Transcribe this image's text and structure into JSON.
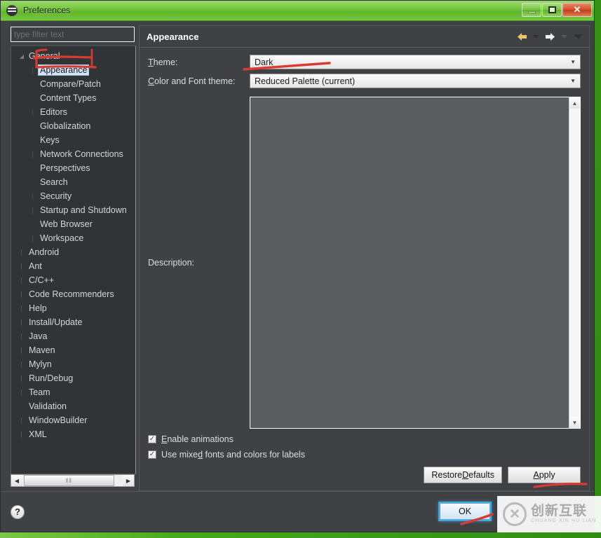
{
  "window": {
    "title": "Preferences",
    "icon": "preferences-icon",
    "buttons": {
      "minimize": "minimize",
      "maximize": "maximize",
      "close": "✕"
    }
  },
  "filter": {
    "placeholder": "type filter text",
    "value": ""
  },
  "tree": {
    "items": [
      {
        "label": "General",
        "level": 1,
        "state": "expanded",
        "selected": false
      },
      {
        "label": "Appearance",
        "level": 2,
        "state": "collapsed",
        "selected": true
      },
      {
        "label": "Compare/Patch",
        "level": 2,
        "state": "none",
        "selected": false
      },
      {
        "label": "Content Types",
        "level": 2,
        "state": "none",
        "selected": false
      },
      {
        "label": "Editors",
        "level": 2,
        "state": "collapsed",
        "selected": false
      },
      {
        "label": "Globalization",
        "level": 2,
        "state": "none",
        "selected": false
      },
      {
        "label": "Keys",
        "level": 2,
        "state": "none",
        "selected": false
      },
      {
        "label": "Network Connections",
        "level": 2,
        "state": "collapsed",
        "selected": false
      },
      {
        "label": "Perspectives",
        "level": 2,
        "state": "none",
        "selected": false
      },
      {
        "label": "Search",
        "level": 2,
        "state": "none",
        "selected": false
      },
      {
        "label": "Security",
        "level": 2,
        "state": "collapsed",
        "selected": false
      },
      {
        "label": "Startup and Shutdown",
        "level": 2,
        "state": "collapsed",
        "selected": false
      },
      {
        "label": "Web Browser",
        "level": 2,
        "state": "none",
        "selected": false
      },
      {
        "label": "Workspace",
        "level": 2,
        "state": "collapsed",
        "selected": false
      },
      {
        "label": "Android",
        "level": 1,
        "state": "collapsed",
        "selected": false
      },
      {
        "label": "Ant",
        "level": 1,
        "state": "collapsed",
        "selected": false
      },
      {
        "label": "C/C++",
        "level": 1,
        "state": "collapsed",
        "selected": false
      },
      {
        "label": "Code Recommenders",
        "level": 1,
        "state": "collapsed",
        "selected": false
      },
      {
        "label": "Help",
        "level": 1,
        "state": "collapsed",
        "selected": false
      },
      {
        "label": "Install/Update",
        "level": 1,
        "state": "collapsed",
        "selected": false
      },
      {
        "label": "Java",
        "level": 1,
        "state": "collapsed",
        "selected": false
      },
      {
        "label": "Maven",
        "level": 1,
        "state": "collapsed",
        "selected": false
      },
      {
        "label": "Mylyn",
        "level": 1,
        "state": "collapsed",
        "selected": false
      },
      {
        "label": "Run/Debug",
        "level": 1,
        "state": "collapsed",
        "selected": false
      },
      {
        "label": "Team",
        "level": 1,
        "state": "collapsed",
        "selected": false
      },
      {
        "label": "Validation",
        "level": 1,
        "state": "none",
        "selected": false
      },
      {
        "label": "WindowBuilder",
        "level": 1,
        "state": "collapsed",
        "selected": false
      },
      {
        "label": "XML",
        "level": 1,
        "state": "collapsed",
        "selected": false
      }
    ],
    "hscroll": {
      "left_arrow": "◀",
      "right_arrow": "▶",
      "grip": "‖‖"
    }
  },
  "page": {
    "title": "Appearance",
    "nav": {
      "back": "back-arrow",
      "back_menu": "back-dropdown",
      "forward": "forward-arrow",
      "forward_menu": "forward-dropdown",
      "view_menu": "view-menu"
    },
    "theme": {
      "label": "Theme:",
      "label_mnemonic": "T",
      "label_rest": "heme:",
      "value": "Dark",
      "caret": "▼"
    },
    "color_font": {
      "label": "Color and Font theme:",
      "label_mnemonic": "C",
      "label_rest": "olor and Font theme:",
      "value": "Reduced Palette (current)",
      "caret": "▼"
    },
    "description": {
      "label": "Description:",
      "value": ""
    },
    "scroll": {
      "up": "▲",
      "down": "▼"
    },
    "checkboxes": [
      {
        "label": "Enable animations",
        "checked": true,
        "check": "✓"
      },
      {
        "label": "Use mixed fonts and colors for labels",
        "checked": true,
        "check": "✓"
      }
    ],
    "buttons": {
      "restore_defaults": "Restore Defaults",
      "apply": "Apply"
    }
  },
  "footer": {
    "help": "?",
    "ok": "OK"
  },
  "watermark": {
    "logo": "✕",
    "cn": "创新互联",
    "en": "CHUANG XIN HU LIAN"
  },
  "colors": {
    "desktop_green": "#46a81c",
    "window_bg": "#3f4144",
    "tree_bg": "#313437",
    "selection": "#d3e3f5",
    "annotation_red": "#d93b30",
    "focus_blue": "#3ca8e6",
    "back_arrow": "#e8c56a",
    "forward_arrow": "#f2f2f2"
  }
}
